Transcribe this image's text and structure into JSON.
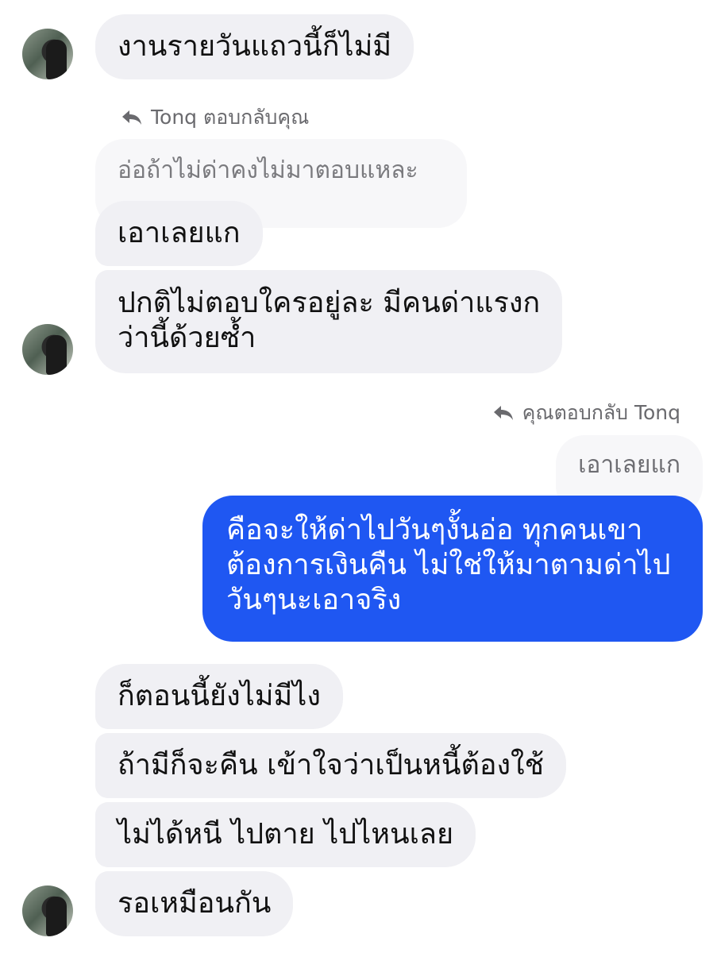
{
  "messages": {
    "m1": "งานรายวันแถวนี้ก็ไม่มี",
    "reply_meta_1": "Tonq ตอบกลับคุณ",
    "quote_1": "อ่อถ้าไม่ด่าคงไม่มาตอบแหละ",
    "m2": "เอาเลยแก",
    "m3_line1": "ปกติไม่ตอบใครอยู่ละ มีคนด่าแรงก",
    "m3_line2": "ว่านี้ด้วยซ้ำ",
    "reply_meta_2": "คุณตอบกลับ Tonq",
    "quote_2": "เอาเลยแก",
    "out_line1": "คือจะให้ด่าไปวันๆงั้นอ่อ ทุกคนเขา",
    "out_line2": "ต้องการเงินคืน ไม่ใช่ให้มาตามด่าไป",
    "out_line3": "วันๆนะเอาจริง",
    "m4": "ก็ตอนนี้ยังไม่มีไง",
    "m5": "ถ้ามีก็จะคืน เข้าใจว่าเป็นหนี้ต้องใช้",
    "m6": "ไม่ได้หนี ไปตาย ไปไหนเลย",
    "m7": "รอเหมือนกัน"
  },
  "colors": {
    "incoming_bubble": "#f0f0f4",
    "outgoing_bubble": "#1f57f2",
    "meta_text": "#6a6a6e"
  },
  "icons": {
    "reply": "reply-arrow-icon",
    "avatar": "contact-avatar"
  }
}
